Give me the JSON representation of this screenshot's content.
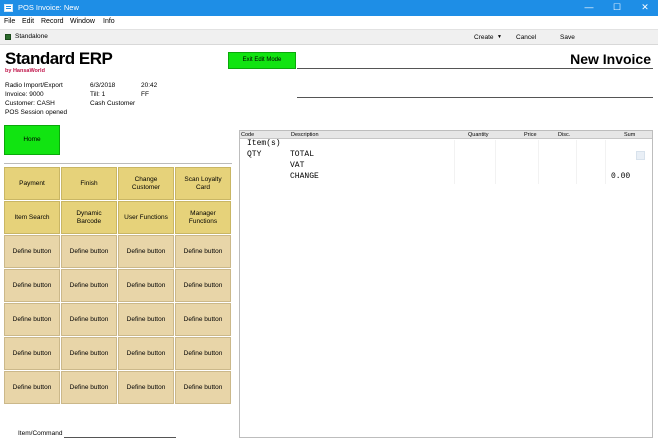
{
  "window": {
    "title": "POS Invoice: New",
    "controls": [
      "—",
      "☐",
      "✕"
    ]
  },
  "menubar": {
    "items": [
      "File",
      "Edit",
      "Record",
      "Window",
      "Info"
    ]
  },
  "toolbar": {
    "mode_label": "Standalone",
    "create": "Create",
    "cancel": "Cancel",
    "save": "Save"
  },
  "header": {
    "logo": "Standard ERP",
    "logo_sub": "by HansaWorld",
    "edit_mode_button": "Exit Edit Mode",
    "doc_title": "New Invoice"
  },
  "info": {
    "company": "Radio Import/Export",
    "date": "6/3/2018",
    "time": "20:42",
    "invoice": "Invoice: 9000",
    "till": "Till: 1",
    "ff": "FF",
    "customer": "Customer: CASH",
    "customer_name": "Cash Customer",
    "session": "POS Session opened"
  },
  "home_button": "Home",
  "pos_buttons": [
    {
      "label": "Payment",
      "kind": "func"
    },
    {
      "label": "Finish",
      "kind": "func"
    },
    {
      "label": "Change Customer",
      "kind": "func"
    },
    {
      "label": "Scan Loyalty Card",
      "kind": "func"
    },
    {
      "label": "Item Search",
      "kind": "func"
    },
    {
      "label": "Dynamic Barcode",
      "kind": "func"
    },
    {
      "label": "User Functions",
      "kind": "func"
    },
    {
      "label": "Manager Functions",
      "kind": "func"
    },
    {
      "label": "Define button",
      "kind": "define"
    },
    {
      "label": "Define button",
      "kind": "define"
    },
    {
      "label": "Define button",
      "kind": "define"
    },
    {
      "label": "Define button",
      "kind": "define"
    },
    {
      "label": "Define button",
      "kind": "define"
    },
    {
      "label": "Define button",
      "kind": "define"
    },
    {
      "label": "Define button",
      "kind": "define"
    },
    {
      "label": "Define button",
      "kind": "define"
    },
    {
      "label": "Define button",
      "kind": "define"
    },
    {
      "label": "Define button",
      "kind": "define"
    },
    {
      "label": "Define button",
      "kind": "define"
    },
    {
      "label": "Define button",
      "kind": "define"
    },
    {
      "label": "Define button",
      "kind": "define"
    },
    {
      "label": "Define button",
      "kind": "define"
    },
    {
      "label": "Define button",
      "kind": "define"
    },
    {
      "label": "Define button",
      "kind": "define"
    },
    {
      "label": "Define button",
      "kind": "define"
    },
    {
      "label": "Define button",
      "kind": "define"
    },
    {
      "label": "Define button",
      "kind": "define"
    },
    {
      "label": "Define button",
      "kind": "define"
    }
  ],
  "item_command_label": "Item/Command",
  "grid": {
    "columns": [
      "Code",
      "Description",
      "Quantity",
      "Price",
      "Disc.",
      "Sum"
    ],
    "receipt": {
      "items_line": "Item(s)",
      "qty": "QTY",
      "total": "TOTAL",
      "vat": "VAT",
      "change": "CHANGE",
      "change_value": "0.00"
    }
  },
  "colors": {
    "titlebar": "#1e8ee6",
    "green_button": "#11e411",
    "func_button": "#e6d27a",
    "define_button": "#e8d5a8",
    "logo_sub": "#c0154a"
  }
}
